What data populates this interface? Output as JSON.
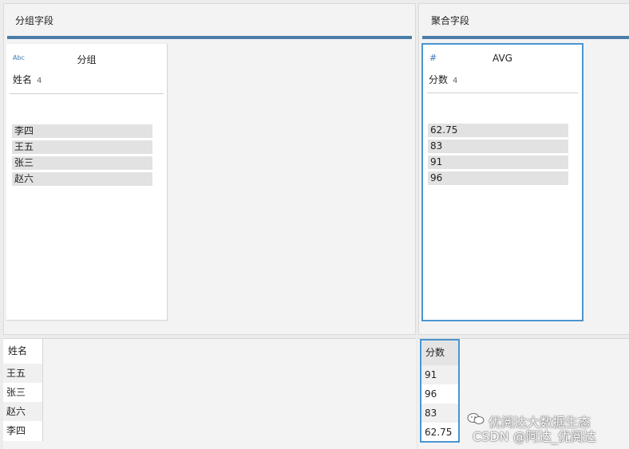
{
  "left_pane": {
    "title": "分组字段",
    "card": {
      "type_icon": "Abc",
      "header": "分组",
      "field_name": "姓名",
      "field_count": "4",
      "values": [
        "李四",
        "王五",
        "张三",
        "赵六"
      ]
    }
  },
  "right_pane": {
    "title": "聚合字段",
    "card": {
      "type_icon": "#",
      "header": "AVG",
      "field_name": "分数",
      "field_count": "4",
      "values": [
        "62.75",
        "83",
        "91",
        "96"
      ]
    }
  },
  "left_table": {
    "header": "姓名",
    "rows": [
      "王五",
      "张三",
      "赵六",
      "李四"
    ]
  },
  "right_table": {
    "header": "分数",
    "rows": [
      "91",
      "96",
      "83",
      "62.75"
    ]
  },
  "watermark": {
    "line1": "优阅达大数据生态",
    "line2": "CSDN @阿达_优阅达"
  },
  "colors": {
    "accent_bar": "#4a7da8",
    "selection_border": "#4a95cf",
    "type_icon": "#3a76b5"
  }
}
